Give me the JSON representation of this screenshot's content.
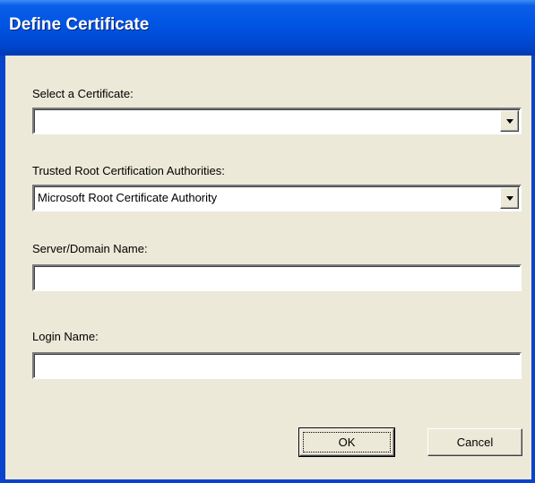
{
  "window": {
    "title": "Define Certificate"
  },
  "form": {
    "certificate": {
      "label": "Select a Certificate:",
      "value": ""
    },
    "trusted_root": {
      "label": "Trusted Root Certification Authorities:",
      "value": "Microsoft Root Certificate Authority"
    },
    "server_domain": {
      "label": "Server/Domain Name:",
      "value": ""
    },
    "login_name": {
      "label": "Login Name:",
      "value": ""
    }
  },
  "buttons": {
    "ok_label": "OK",
    "cancel_label": "Cancel"
  },
  "icons": {
    "dropdown": "chevron-down-icon"
  },
  "colors": {
    "titlebar": "#0054e3",
    "frame": "#0a44cc",
    "dialog_background": "#ece9d8"
  }
}
